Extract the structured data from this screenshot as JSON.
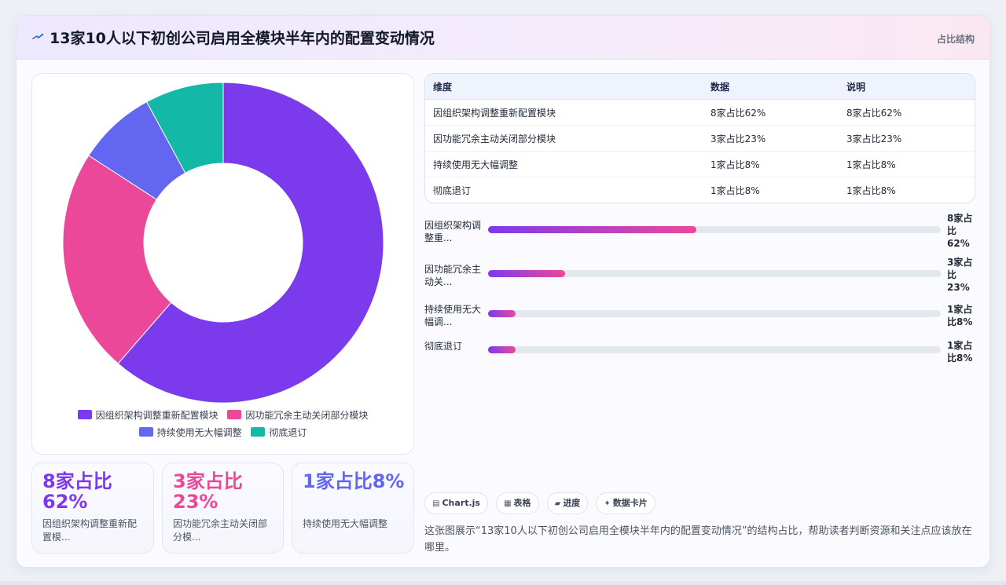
{
  "header": {
    "title": "13家10人以下初创公司启用全模块半年内的配置变动情况",
    "right_label": "占比结构",
    "icon": "sparkle-icon"
  },
  "chart_data": {
    "type": "pie",
    "variant": "doughnut",
    "categories": [
      "因组织架构调整重新配置模块",
      "因功能冗余主动关闭部分模块",
      "持续使用无大幅调整",
      "彻底退订"
    ],
    "counts": [
      8,
      3,
      1,
      1
    ],
    "values": [
      62,
      23,
      8,
      8
    ],
    "colors": [
      "#7c3aed",
      "#ec4899",
      "#6366f1",
      "#14b8a6"
    ],
    "legend_position": "bottom"
  },
  "kpis": [
    {
      "value": "8家占比62%",
      "label": "因组织架构调整重新配置模...",
      "color": "#7c3aed"
    },
    {
      "value": "3家占比23%",
      "label": "因功能冗余主动关闭部分模...",
      "color": "#ec4899"
    },
    {
      "value": "1家占比8%",
      "label": "持续使用无大幅调整",
      "color": "#6366f1"
    }
  ],
  "table": {
    "headers": [
      "维度",
      "数据",
      "说明"
    ],
    "rows": [
      [
        "因组织架构调整重新配置模块",
        "8家占比62%",
        "8家占比62%"
      ],
      [
        "因功能冗余主动关闭部分模块",
        "3家占比23%",
        "3家占比23%"
      ],
      [
        "持续使用无大幅调整",
        "1家占比8%",
        "1家占比8%"
      ],
      [
        "彻底退订",
        "1家占比8%",
        "1家占比8%"
      ]
    ]
  },
  "bars": [
    {
      "label": "因组织架构调整重...",
      "value_text": "8家占比62%",
      "percent": 46
    },
    {
      "label": "因功能冗余主动关...",
      "value_text": "3家占比23%",
      "percent": 17
    },
    {
      "label": "持续使用无大幅调...",
      "value_text": "1家占比8%",
      "percent": 6
    },
    {
      "label": "彻底退订",
      "value_text": "1家占比8%",
      "percent": 6
    }
  ],
  "chips": [
    {
      "icon": "chart-icon",
      "label": "Chart.js"
    },
    {
      "icon": "table-icon",
      "label": "表格"
    },
    {
      "icon": "progress-icon",
      "label": "进度"
    },
    {
      "icon": "sparkle-icon",
      "label": "数据卡片"
    }
  ],
  "description": "这张图展示“13家10人以下初创公司启用全模块半年内的配置变动情况”的结构占比，帮助读者判断资源和关注点应该放在哪里。"
}
